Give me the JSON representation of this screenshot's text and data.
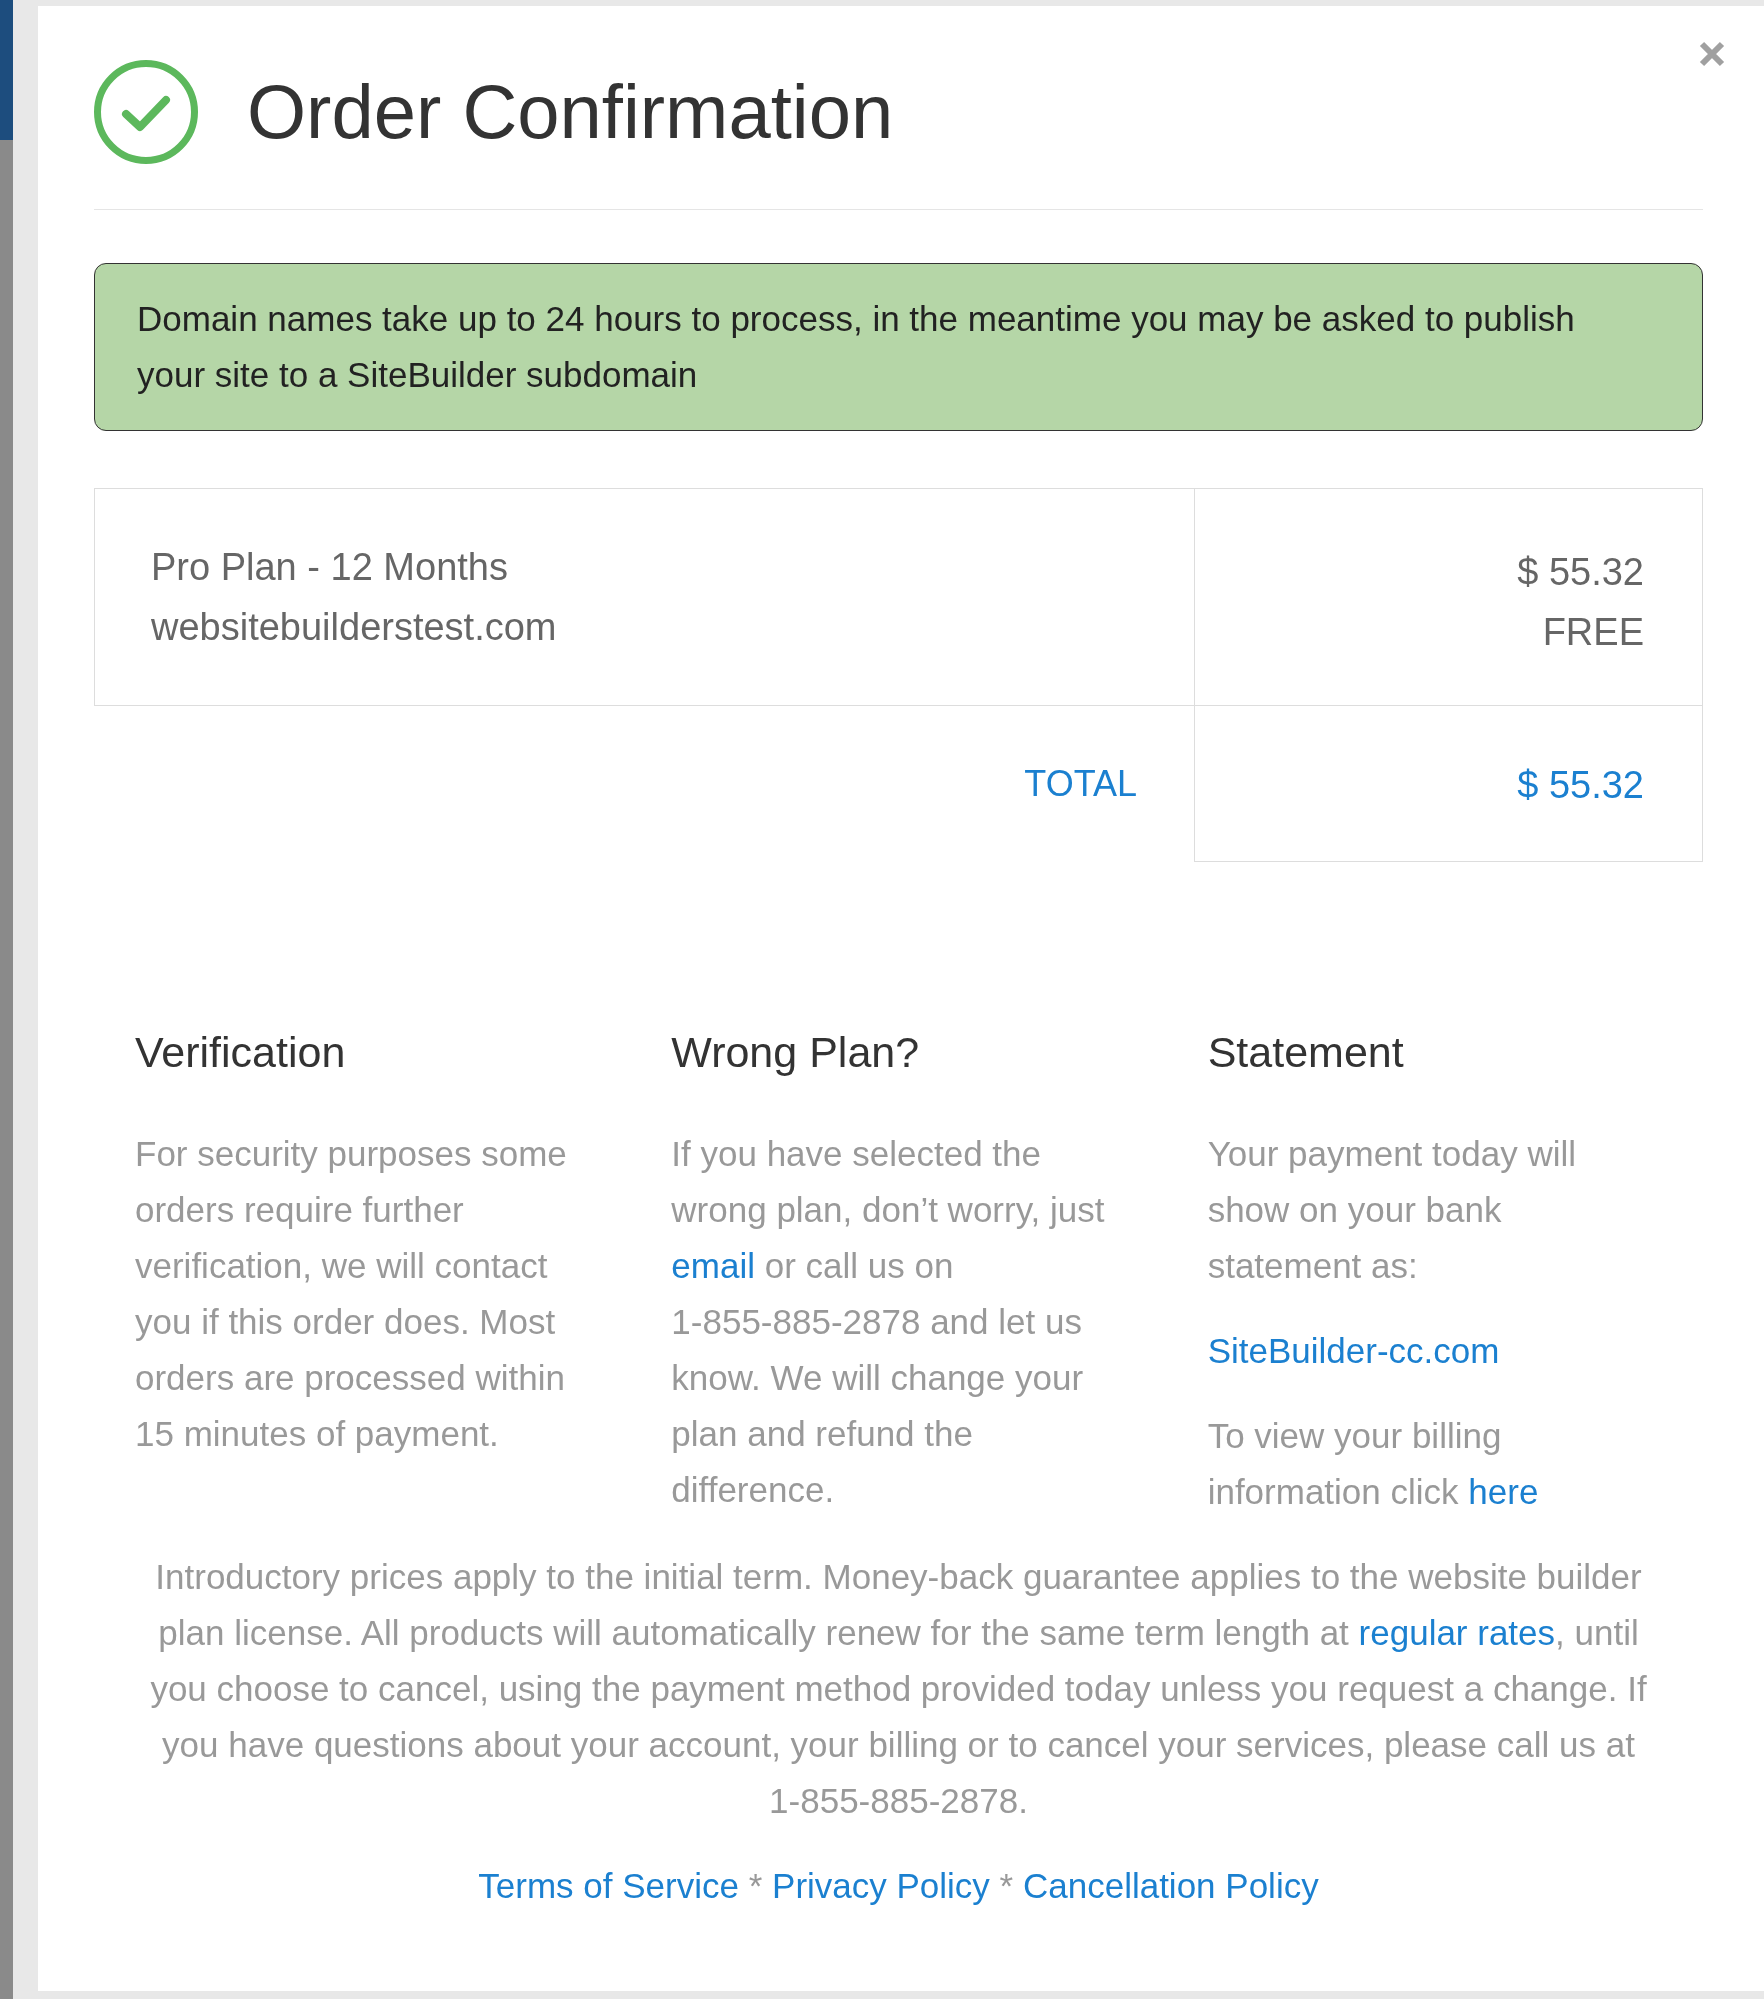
{
  "header": {
    "title": "Order Confirmation"
  },
  "alert": {
    "text": "Domain names take up to 24 hours to process, in the meantime you may be asked to publish your site to a SiteBuilder subdomain"
  },
  "order_table": {
    "items": [
      {
        "lines": [
          "Pro Plan - 12 Months",
          "websitebuilderstest.com"
        ],
        "amounts": [
          "$ 55.32",
          "FREE"
        ]
      }
    ],
    "total": {
      "label": "TOTAL",
      "amount": "$ 55.32"
    }
  },
  "info_columns": [
    {
      "heading": "Verification",
      "blocks": [
        {
          "kind": "paragraph",
          "segments": [
            {
              "kind": "text",
              "text": "For security purposes some orders require further verification, we will contact you if this order does. Most orders are processed within 15 minutes of payment."
            }
          ]
        }
      ]
    },
    {
      "heading": "Wrong Plan?",
      "blocks": [
        {
          "kind": "paragraph",
          "segments": [
            {
              "kind": "text",
              "text": "If you have selected the wrong plan, don’t worry, just "
            },
            {
              "kind": "link",
              "text": "email"
            },
            {
              "kind": "text",
              "text": " or call us on 1-855-885-2878 and let us know. We will change your plan and refund the difference."
            }
          ]
        }
      ]
    },
    {
      "heading": "Statement",
      "blocks": [
        {
          "kind": "paragraph",
          "segments": [
            {
              "kind": "text",
              "text": "Your payment today will show on your bank statement as:"
            }
          ]
        },
        {
          "kind": "link",
          "text": "SiteBuilder-cc.com"
        },
        {
          "kind": "paragraph",
          "segments": [
            {
              "kind": "text",
              "text": "To view your billing information click "
            },
            {
              "kind": "link",
              "text": "here"
            }
          ]
        }
      ]
    }
  ],
  "notice": {
    "segments": [
      {
        "kind": "text",
        "text": "Introductory prices apply to the initial term. Money-back guarantee applies to the website builder plan license. All products will automatically renew for the same term length at "
      },
      {
        "kind": "link",
        "text": "regular rates"
      },
      {
        "kind": "text",
        "text": ", until you choose to cancel, using the payment method provided today unless you request a change. If you have questions about your account, your billing or to cancel your services, please call us at 1-855-885-2878."
      }
    ]
  },
  "footer_links": [
    {
      "kind": "link",
      "text": "Terms of Service"
    },
    {
      "kind": "separator",
      "text": "*"
    },
    {
      "kind": "link",
      "text": "Privacy Policy"
    },
    {
      "kind": "separator",
      "text": "*"
    },
    {
      "kind": "link",
      "text": "Cancellation Policy"
    }
  ]
}
